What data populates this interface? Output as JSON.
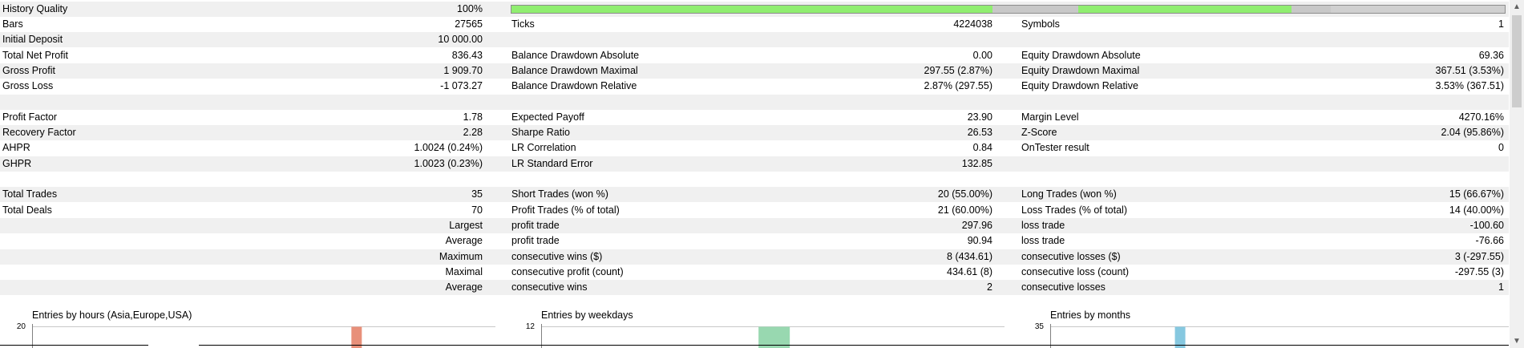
{
  "history_quality": {
    "label": "History Quality",
    "value": "100%",
    "bar_segments": [
      {
        "fraction": 0.484,
        "color": "#90ee70"
      },
      {
        "fraction": 0.087,
        "color": "#c8c8c8"
      },
      {
        "fraction": 0.214,
        "color": "#90ee70"
      },
      {
        "fraction": 0.04,
        "color": "#c8c8c8"
      }
    ]
  },
  "rows": [
    {
      "c1l": "Bars",
      "c1v": "27565",
      "c2l": "Ticks",
      "c2v": "4224038",
      "c3l": "Symbols",
      "c3v": "1"
    },
    {
      "c1l": "Initial Deposit",
      "c1v": "10 000.00",
      "c2l": "",
      "c2v": "",
      "c3l": "",
      "c3v": ""
    },
    {
      "c1l": "Total Net Profit",
      "c1v": "836.43",
      "c2l": "Balance Drawdown Absolute",
      "c2v": "0.00",
      "c3l": "Equity Drawdown Absolute",
      "c3v": "69.36"
    },
    {
      "c1l": "Gross Profit",
      "c1v": "1 909.70",
      "c2l": "Balance Drawdown Maximal",
      "c2v": "297.55 (2.87%)",
      "c3l": "Equity Drawdown Maximal",
      "c3v": "367.51 (3.53%)"
    },
    {
      "c1l": "Gross Loss",
      "c1v": "-1 073.27",
      "c2l": "Balance Drawdown Relative",
      "c2v": "2.87% (297.55)",
      "c3l": "Equity Drawdown Relative",
      "c3v": "3.53% (367.51)"
    },
    {
      "c1l": "",
      "c1v": "",
      "c2l": "",
      "c2v": "",
      "c3l": "",
      "c3v": ""
    },
    {
      "c1l": "Profit Factor",
      "c1v": "1.78",
      "c2l": "Expected Payoff",
      "c2v": "23.90",
      "c3l": "Margin Level",
      "c3v": "4270.16%"
    },
    {
      "c1l": "Recovery Factor",
      "c1v": "2.28",
      "c2l": "Sharpe Ratio",
      "c2v": "26.53",
      "c3l": "Z-Score",
      "c3v": "2.04 (95.86%)"
    },
    {
      "c1l": "AHPR",
      "c1v": "1.0024 (0.24%)",
      "c2l": "LR Correlation",
      "c2v": "0.84",
      "c3l": "OnTester result",
      "c3v": "0"
    },
    {
      "c1l": "GHPR",
      "c1v": "1.0023 (0.23%)",
      "c2l": "LR Standard Error",
      "c2v": "132.85",
      "c3l": "",
      "c3v": ""
    },
    {
      "c1l": "",
      "c1v": "",
      "c2l": "",
      "c2v": "",
      "c3l": "",
      "c3v": ""
    },
    {
      "c1l": "Total Trades",
      "c1v": "35",
      "c2l": "Short Trades (won %)",
      "c2v": "20 (55.00%)",
      "c3l": "Long Trades (won %)",
      "c3v": "15 (66.67%)"
    },
    {
      "c1l": "Total Deals",
      "c1v": "70",
      "c2l": "Profit Trades (% of total)",
      "c2v": "21 (60.00%)",
      "c3l": "Loss Trades (% of total)",
      "c3v": "14 (40.00%)"
    },
    {
      "c1l": "",
      "c1v": "Largest",
      "c2l": "profit trade",
      "c2v": "297.96",
      "c3l": "loss trade",
      "c3v": "-100.60"
    },
    {
      "c1l": "",
      "c1v": "Average",
      "c2l": "profit trade",
      "c2v": "90.94",
      "c3l": "loss trade",
      "c3v": "-76.66"
    },
    {
      "c1l": "",
      "c1v": "Maximum",
      "c2l": "consecutive wins ($)",
      "c2v": "8 (434.61)",
      "c3l": "consecutive losses ($)",
      "c3v": "3 (-297.55)"
    },
    {
      "c1l": "",
      "c1v": "Maximal",
      "c2l": "consecutive profit (count)",
      "c2v": "434.61 (8)",
      "c3l": "consecutive loss (count)",
      "c3v": "-297.55 (3)"
    },
    {
      "c1l": "",
      "c1v": "Average",
      "c2l": "consecutive wins",
      "c2v": "2",
      "c3l": "consecutive losses",
      "c3v": "1"
    },
    {
      "c1l": "",
      "c1v": "",
      "c2l": "",
      "c2v": "",
      "c3l": "",
      "c3v": ""
    }
  ],
  "charts": [
    {
      "title": "Entries by hours (Asia,Europe,USA)",
      "y_max": "20",
      "bar_color": "#e8907a",
      "bar_position": 0.69
    },
    {
      "title": "Entries by weekdays",
      "y_max": "12",
      "bar_color": "#98d8b0",
      "bar_position": 0.47
    },
    {
      "title": "Entries by months",
      "y_max": "35",
      "bar_color": "#86c8e0",
      "bar_position": 0.27
    }
  ],
  "scrollbar": {
    "up_icon": "▲",
    "down_icon": "▼"
  }
}
